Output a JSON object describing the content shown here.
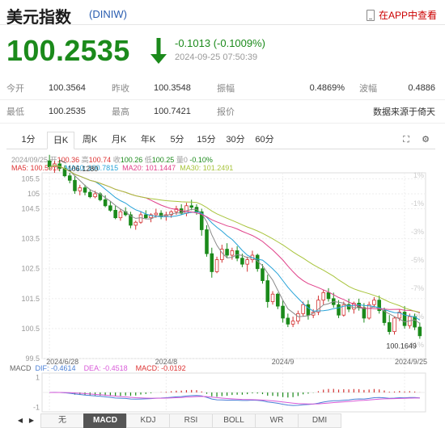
{
  "header": {
    "title": "美元指数",
    "code": "(DINIW)",
    "app_link": "在APP中查看"
  },
  "quote": {
    "price": "100.2535",
    "change": "-0.1013 (-0.1009%)",
    "timestamp": "2024-09-25 07:50:39"
  },
  "stats": {
    "row1": [
      {
        "label": "今开",
        "value": "100.3564"
      },
      {
        "label": "昨收",
        "value": "100.3548"
      },
      {
        "label": "振幅",
        "value": "0.4869%"
      },
      {
        "label": "波幅",
        "value": "0.4886"
      }
    ],
    "row2": [
      {
        "label": "最低",
        "value": "100.2535"
      },
      {
        "label": "最高",
        "value": "100.7421"
      },
      {
        "label": "报价",
        "value": ""
      }
    ],
    "source": "数据来源于倚天"
  },
  "tabs": [
    "1分",
    "日K",
    "周K",
    "月K",
    "年K",
    "5分",
    "15分",
    "30分",
    "60分"
  ],
  "active_tab": "日K",
  "candle_info": {
    "date": "2024/09/25",
    "open_label": "开",
    "open": "100.36",
    "high_label": "高",
    "high": "100.74",
    "close_label": "收",
    "close": "100.26",
    "low_label": "低",
    "low": "100.25",
    "change_label": "量",
    "change": "0",
    "pct": "-0.10%"
  },
  "ma_info": {
    "ma5": "MA5: 100.5910",
    "ma10": "MA10: 100.7815",
    "ma20": "MA20: 101.1447",
    "ma30": "MA30: 101.2491"
  },
  "macd_info": {
    "label": "MACD",
    "dif": "DIF: -0.4614",
    "dea": "DEA: -0.4518",
    "macd": "MACD: -0.0192"
  },
  "indicator_buttons": [
    "无",
    "MACD",
    "KDJ",
    "RSI",
    "BOLL",
    "WR",
    "DMI"
  ],
  "active_indicator": "MACD",
  "colors": {
    "up": "#d33333",
    "down": "#1b8a1b",
    "ma5": "#8a8a8a",
    "ma10": "#27a3d8",
    "ma20": "#e0418a",
    "ma30": "#a8c43c",
    "dif": "#4a7fd6",
    "dea": "#d85ad8"
  },
  "chart_data": {
    "type": "candlestick",
    "y_ticks": [
      "105.5",
      "105",
      "104.5",
      "103.5",
      "102.5",
      "101.5",
      "100.5",
      "99.5"
    ],
    "y_tick_values": [
      105.5,
      105.0,
      104.5,
      103.5,
      102.5,
      101.5,
      100.5,
      99.5
    ],
    "pct_ticks": [
      "1%",
      "-1%",
      "-3%",
      "-5%",
      "-7%",
      "-9%",
      "-11%"
    ],
    "x_ticks": [
      "2024/6/28",
      "2024/8",
      "2024/9",
      "2024/9/25"
    ],
    "max_label": "106.1280",
    "min_label": "100.1649",
    "macd_ticks": [
      "1",
      "0",
      "-1"
    ],
    "ohlc": [
      [
        106.1,
        106.3,
        105.8,
        105.9
      ],
      [
        105.9,
        106.1,
        105.7,
        106.0
      ],
      [
        106.0,
        106.13,
        105.75,
        105.85
      ],
      [
        105.85,
        105.95,
        105.55,
        105.6
      ],
      [
        105.6,
        105.7,
        105.35,
        105.45
      ],
      [
        105.45,
        105.6,
        105.0,
        105.1
      ],
      [
        105.1,
        105.3,
        104.95,
        105.2
      ],
      [
        105.2,
        105.3,
        104.95,
        105.05
      ],
      [
        105.05,
        105.15,
        104.85,
        104.9
      ],
      [
        104.9,
        105.1,
        104.85,
        105.0
      ],
      [
        105.0,
        105.05,
        104.75,
        104.8
      ],
      [
        104.8,
        104.95,
        104.55,
        104.6
      ],
      [
        104.6,
        104.75,
        104.4,
        104.45
      ],
      [
        104.45,
        104.6,
        104.15,
        104.2
      ],
      [
        104.2,
        104.5,
        104.1,
        104.4
      ],
      [
        104.4,
        104.55,
        104.25,
        104.3
      ],
      [
        104.3,
        104.4,
        103.85,
        103.95
      ],
      [
        103.95,
        104.1,
        103.8,
        104.05
      ],
      [
        104.05,
        104.4,
        104.0,
        104.3
      ],
      [
        104.3,
        104.45,
        104.15,
        104.2
      ],
      [
        104.2,
        104.35,
        104.05,
        104.3
      ],
      [
        104.3,
        104.5,
        104.2,
        104.35
      ],
      [
        104.35,
        104.45,
        104.15,
        104.25
      ],
      [
        104.25,
        104.4,
        104.1,
        104.3
      ],
      [
        104.3,
        104.45,
        104.2,
        104.4
      ],
      [
        104.4,
        104.6,
        104.3,
        104.5
      ],
      [
        104.5,
        104.65,
        104.3,
        104.35
      ],
      [
        104.35,
        104.7,
        104.25,
        104.6
      ],
      [
        104.6,
        104.8,
        104.45,
        104.55
      ],
      [
        104.55,
        104.65,
        104.3,
        104.4
      ],
      [
        104.4,
        104.5,
        103.6,
        103.8
      ],
      [
        103.8,
        103.95,
        102.9,
        103.0
      ],
      [
        103.0,
        103.2,
        102.2,
        102.4
      ],
      [
        102.4,
        102.9,
        102.35,
        102.8
      ],
      [
        102.8,
        103.3,
        102.7,
        103.15
      ],
      [
        103.15,
        103.35,
        102.85,
        102.95
      ],
      [
        102.95,
        103.2,
        102.8,
        103.1
      ],
      [
        103.1,
        103.25,
        102.75,
        102.85
      ],
      [
        102.85,
        103.0,
        102.55,
        102.65
      ],
      [
        102.65,
        102.9,
        102.4,
        102.8
      ],
      [
        102.8,
        103.1,
        102.7,
        102.95
      ],
      [
        102.95,
        103.0,
        102.4,
        102.5
      ],
      [
        102.5,
        102.65,
        102.0,
        102.1
      ],
      [
        102.1,
        102.3,
        101.2,
        101.4
      ],
      [
        101.4,
        101.75,
        101.3,
        101.65
      ],
      [
        101.65,
        101.7,
        101.15,
        101.25
      ],
      [
        101.25,
        101.45,
        100.7,
        100.85
      ],
      [
        100.85,
        101.0,
        100.55,
        100.65
      ],
      [
        100.65,
        100.9,
        100.55,
        100.75
      ],
      [
        100.75,
        101.1,
        100.65,
        101.0
      ],
      [
        101.0,
        101.4,
        100.9,
        101.3
      ],
      [
        101.3,
        101.45,
        100.8,
        100.95
      ],
      [
        100.95,
        101.15,
        100.85,
        101.05
      ],
      [
        101.05,
        101.6,
        100.95,
        101.45
      ],
      [
        101.45,
        101.8,
        101.3,
        101.7
      ],
      [
        101.7,
        101.85,
        101.4,
        101.5
      ],
      [
        101.5,
        101.7,
        101.2,
        101.3
      ],
      [
        101.3,
        101.45,
        100.85,
        100.95
      ],
      [
        100.95,
        101.4,
        100.9,
        101.3
      ],
      [
        101.3,
        101.5,
        101.05,
        101.15
      ],
      [
        101.15,
        101.4,
        101.0,
        101.35
      ],
      [
        101.35,
        101.5,
        101.1,
        101.2
      ],
      [
        101.2,
        101.35,
        100.7,
        100.85
      ],
      [
        100.85,
        101.4,
        100.8,
        101.3
      ],
      [
        101.3,
        101.55,
        101.2,
        101.45
      ],
      [
        101.45,
        101.6,
        101.0,
        101.1
      ],
      [
        101.1,
        101.2,
        100.6,
        100.7
      ],
      [
        100.7,
        100.95,
        100.3,
        100.4
      ],
      [
        100.4,
        100.9,
        100.3,
        100.85
      ],
      [
        100.85,
        101.15,
        100.75,
        101.05
      ],
      [
        101.05,
        101.25,
        100.5,
        100.6
      ],
      [
        100.6,
        101.0,
        100.5,
        100.9
      ],
      [
        100.9,
        101.0,
        100.45,
        100.55
      ],
      [
        100.55,
        100.7,
        100.16,
        100.26
      ]
    ]
  }
}
